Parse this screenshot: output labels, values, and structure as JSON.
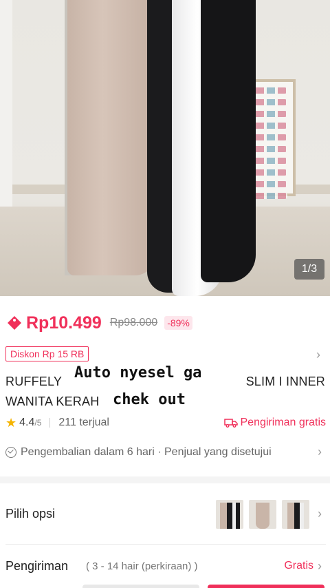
{
  "photo": {
    "counter": "1/3"
  },
  "price": {
    "current": "Rp10.499",
    "original": "Rp98.000",
    "discount_pct": "-89%"
  },
  "voucher": {
    "label": "Diskon Rp 15 RB"
  },
  "product": {
    "title_line1": "RUFFELY",
    "title_line1_right": "SLIM I INNER",
    "title_line2": "WANITA KERAH"
  },
  "overlay_caption": {
    "line1": "Auto nyesel ga",
    "line2": "chek out"
  },
  "stats": {
    "rating": "4.4",
    "rating_max": "/5",
    "sold": "211 terjual",
    "free_shipping": "Pengiriman gratis"
  },
  "returns": {
    "text": "Pengembalian dalam 6 hari · Penjual yang disetujui"
  },
  "options": {
    "label": "Pilih opsi"
  },
  "shipping": {
    "label": "Pengiriman",
    "estimate": "( 3 - 14 hair (perkiraan) )",
    "cost": "Gratis"
  },
  "colors": {
    "accent": "#f0305a",
    "star": "#f5b400"
  }
}
